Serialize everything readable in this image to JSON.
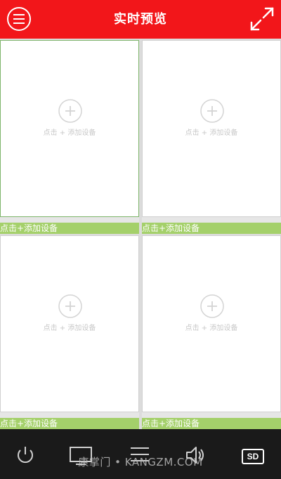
{
  "header": {
    "title": "实时预览",
    "menu_icon": "menu-circle-icon",
    "fullscreen_icon": "expand-arrows-icon",
    "bg_color": "#f2161a"
  },
  "grid": {
    "cells": [
      {
        "hint": "点击 + 添加设备",
        "label": "点击+添加设备",
        "selected": true
      },
      {
        "hint": "点击 + 添加设备",
        "label": "点击+添加设备",
        "selected": false
      },
      {
        "hint": "点击 + 添加设备",
        "label": "点击+添加设备",
        "selected": false
      },
      {
        "hint": "点击 + 添加设备",
        "label": "点击+添加设备",
        "selected": false
      }
    ],
    "label_bar_color": "#a4d06a"
  },
  "toolbar": {
    "items": [
      "power-icon",
      "screen-layout-icon",
      "list-icon",
      "volume-icon"
    ],
    "sd_label": "SD",
    "watermark": "康掌门 • KANGZM.COM"
  }
}
